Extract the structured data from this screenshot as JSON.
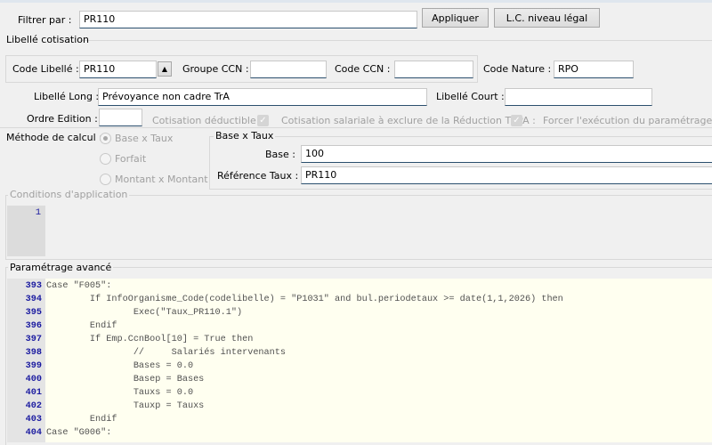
{
  "filter": {
    "label": "Filtrer par :",
    "value": "PR110",
    "apply_button": "Appliquer",
    "legal_button": "L.C. niveau légal"
  },
  "libelle_cotisation": {
    "title": "Libellé cotisation",
    "code_libelle_label": "Code Libellé :",
    "code_libelle_value": "PR110",
    "groupe_ccn_label": "Groupe CCN :",
    "groupe_ccn_value": "",
    "code_ccn_label": "Code CCN :",
    "code_ccn_value": "",
    "code_nature_label": "Code Nature :",
    "code_nature_value": "RPO",
    "libelle_long_label": "Libellé Long :",
    "libelle_long_value": "Prévoyance non cadre TrA",
    "libelle_court_label": "Libellé Court :",
    "libelle_court_value": "",
    "ordre_edition_label": "Ordre Edition :",
    "ordre_edition_value": "",
    "cotisation_deductible_label": "Cotisation déductible :",
    "cotisation_deductible_checked": true,
    "tepa_label": "Cotisation salariale à exclure de la Réduction TEPA :",
    "tepa_checked": true,
    "forcer_label": "Forcer l'exécution du paramétrage avan"
  },
  "methode": {
    "label": "Méthode de calcul :",
    "options": [
      "Base x Taux",
      "Forfait",
      "Montant x Montant"
    ],
    "selected": "Base x Taux"
  },
  "base_taux": {
    "title": "Base x Taux",
    "base_label": "Base :",
    "base_value": "100",
    "ref_label": "Référence Taux :",
    "ref_value": "PR110"
  },
  "conditions": {
    "title": "Conditions d'application",
    "lines": [
      {
        "n": "1",
        "text": ""
      }
    ]
  },
  "parametrage": {
    "title": "Paramétrage avancé",
    "lines": [
      {
        "n": "393",
        "text": "Case \"F005\":"
      },
      {
        "n": "394",
        "text": "        If InfoOrganisme_Code(codelibelle) = \"P1031\" and bul.periodetaux >= date(1,1,2026) then"
      },
      {
        "n": "395",
        "text": "                Exec(\"Taux_PR110.1\")"
      },
      {
        "n": "396",
        "text": "        Endif"
      },
      {
        "n": "397",
        "text": "        If Emp.CcnBool[10] = True then"
      },
      {
        "n": "398",
        "text": "                //     Salariés intervenants"
      },
      {
        "n": "399",
        "text": "                Bases = 0.0"
      },
      {
        "n": "400",
        "text": "                Basep = Bases"
      },
      {
        "n": "401",
        "text": "                Tauxs = 0.0"
      },
      {
        "n": "402",
        "text": "                Tauxp = Tauxs"
      },
      {
        "n": "403",
        "text": "        Endif"
      },
      {
        "n": "404",
        "text": "Case \"G006\":"
      }
    ]
  }
}
